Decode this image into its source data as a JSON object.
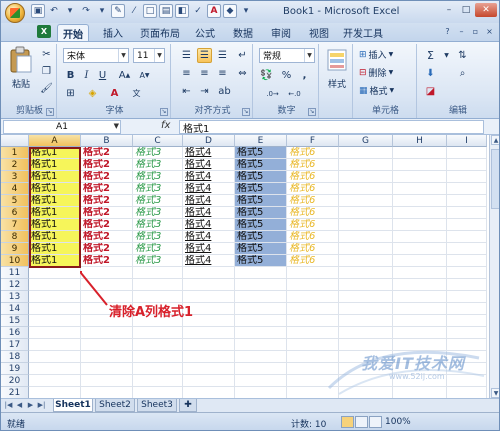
{
  "window": {
    "title": "Book1 - Microsoft Excel"
  },
  "ribbon_tabs": [
    "开始",
    "插入",
    "页面布局",
    "公式",
    "数据",
    "审阅",
    "视图",
    "开发工具"
  ],
  "ribbon": {
    "paste_label": "粘贴",
    "font_name": "宋体",
    "font_size": "11",
    "number_format": "常规",
    "styles_label": "样式",
    "insert_label": "插入",
    "delete_label": "删除",
    "format_label": "格式",
    "groups": {
      "clipboard": "剪贴板",
      "font": "字体",
      "alignment": "对齐方式",
      "number": "数字",
      "cells": "单元格",
      "editing": "编辑"
    }
  },
  "formula_bar": {
    "name_box": "A1",
    "fx": "fx",
    "value": "格式1"
  },
  "columns": [
    "A",
    "B",
    "C",
    "D",
    "E",
    "F",
    "G",
    "H",
    "I"
  ],
  "rows": [
    "1",
    "2",
    "3",
    "4",
    "5",
    "6",
    "7",
    "8",
    "9",
    "10",
    "11",
    "12",
    "13",
    "14",
    "15",
    "16",
    "17",
    "18",
    "19",
    "20",
    "21"
  ],
  "cells": [
    [
      "格式1",
      "格式2",
      "格式3",
      "格式4",
      "格式5",
      "格式6"
    ],
    [
      "格式1",
      "格式2",
      "格式3",
      "格式4",
      "格式5",
      "格式6"
    ],
    [
      "格式1",
      "格式2",
      "格式3",
      "格式4",
      "格式5",
      "格式6"
    ],
    [
      "格式1",
      "格式2",
      "格式3",
      "格式4",
      "格式5",
      "格式6"
    ],
    [
      "格式1",
      "格式2",
      "格式3",
      "格式4",
      "格式5",
      "格式6"
    ],
    [
      "格式1",
      "格式2",
      "格式3",
      "格式4",
      "格式5",
      "格式6"
    ],
    [
      "格式1",
      "格式2",
      "格式3",
      "格式4",
      "格式5",
      "格式6"
    ],
    [
      "格式1",
      "格式2",
      "格式3",
      "格式4",
      "格式5",
      "格式6"
    ],
    [
      "格式1",
      "格式2",
      "格式3",
      "格式4",
      "格式5",
      "格式6"
    ],
    [
      "格式1",
      "格式2",
      "格式3",
      "格式4",
      "格式5",
      "格式6"
    ]
  ],
  "annotation": "清除A列格式1",
  "watermark": {
    "text": "我爱IT技术网",
    "url": "www.52ij.com"
  },
  "sheets": [
    "Sheet1",
    "Sheet2",
    "Sheet3"
  ],
  "status": {
    "mode": "就绪",
    "count": "计数: 10",
    "zoom": "100%"
  },
  "colors": {
    "format1_fill": "#f6f55a",
    "format2_text": "#c0182a",
    "format3_text": "#2c9a4a",
    "format5_fill": "#93afd8",
    "format6_text": "#e9b829",
    "annotation": "#d8212b"
  }
}
